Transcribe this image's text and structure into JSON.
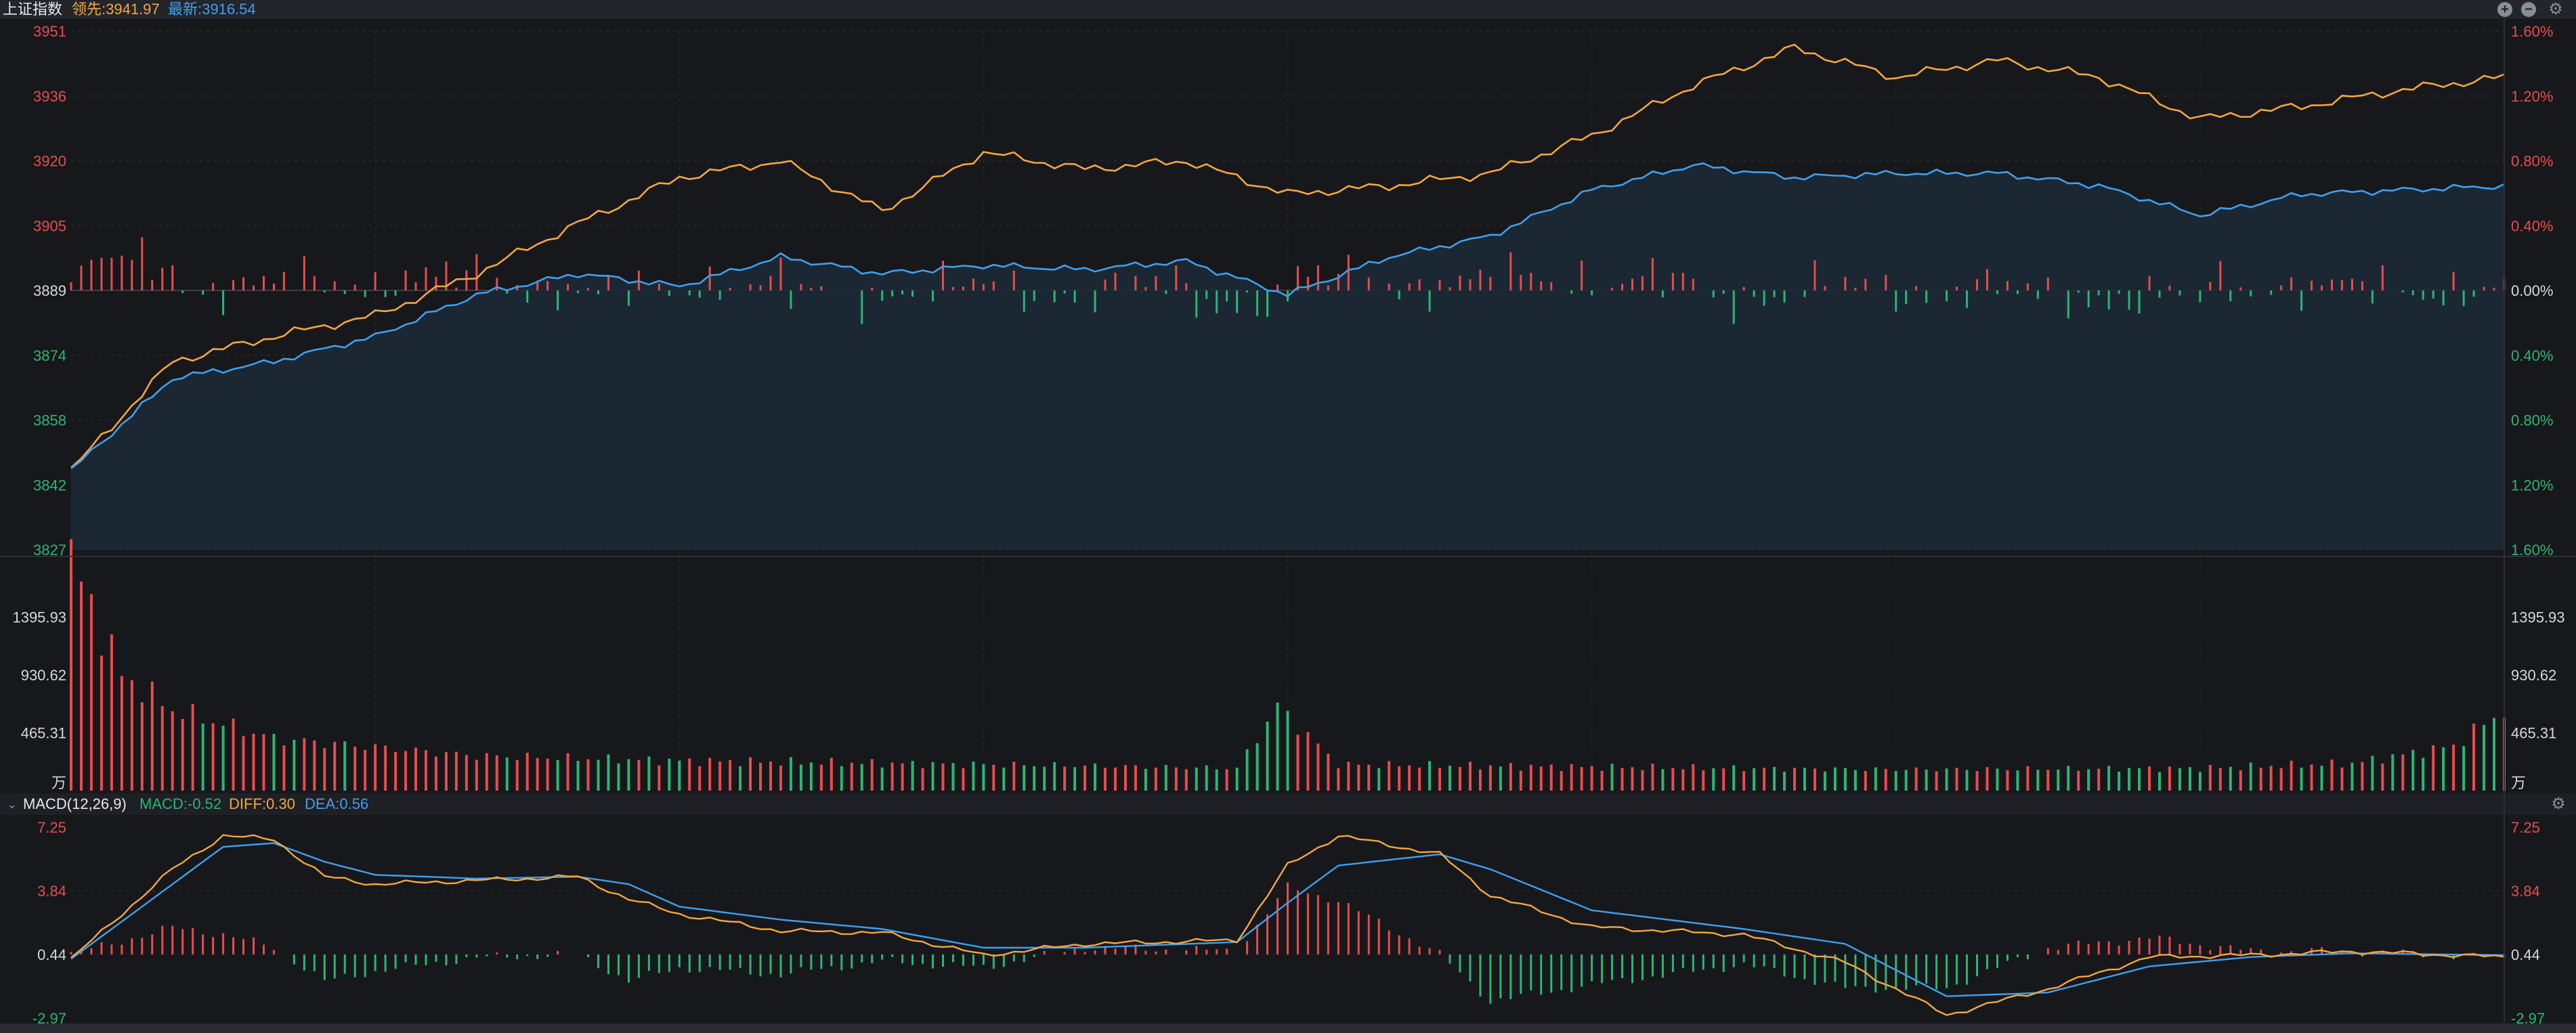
{
  "header": {
    "index_name": "上证指数",
    "lead_text": "领先:3941.97",
    "latest_text": "最新:3916.54"
  },
  "macd_header": {
    "name": "MACD(12,26,9)",
    "macd_text": "MACD:-0.52",
    "diff_text": "DIFF:0.30",
    "dea_text": "DEA:0.56"
  },
  "icons": {
    "zoom_in": "plus-circle-icon",
    "zoom_out": "minus-circle-icon",
    "settings": "gear-icon",
    "collapse": "chevron-down-icon"
  },
  "colors": {
    "up": "#e84c4c",
    "down": "#2bb673",
    "lead_line": "#f5a640",
    "latest_line": "#3fa0f0",
    "background": "#17181c"
  },
  "chart_data": [
    {
      "type": "line",
      "panel": "price",
      "y_left_ticks": [
        "3951",
        "3936",
        "3920",
        "3905",
        "3889",
        "3874",
        "3858",
        "3842",
        "3827"
      ],
      "y_right_ticks": [
        "1.60%",
        "1.20%",
        "0.80%",
        "0.40%",
        "0.00%",
        "0.40%",
        "0.80%",
        "1.20%",
        "1.60%"
      ],
      "ylim": [
        3827,
        3951
      ],
      "baseline": 3889,
      "x_points": 241,
      "series": [
        {
          "name": "领先",
          "color": "#f5a640",
          "keypoints": [
            [
              0,
              3846
            ],
            [
              10,
              3872
            ],
            [
              20,
              3878
            ],
            [
              30,
              3883
            ],
            [
              40,
              3893
            ],
            [
              50,
              3905
            ],
            [
              60,
              3916
            ],
            [
              70,
              3920
            ],
            [
              80,
              3908
            ],
            [
              90,
              3922
            ],
            [
              100,
              3918
            ],
            [
              110,
              3920
            ],
            [
              120,
              3912
            ],
            [
              130,
              3914
            ],
            [
              140,
              3917
            ],
            [
              150,
              3926
            ],
            [
              160,
              3938
            ],
            [
              170,
              3947
            ],
            [
              180,
              3940
            ],
            [
              190,
              3944
            ],
            [
              200,
              3940
            ],
            [
              210,
              3930
            ],
            [
              220,
              3933
            ],
            [
              230,
              3937
            ],
            [
              240,
              3940
            ]
          ]
        },
        {
          "name": "最新",
          "color": "#3fa0f0",
          "keypoints": [
            [
              0,
              3846
            ],
            [
              10,
              3868
            ],
            [
              20,
              3872
            ],
            [
              30,
              3878
            ],
            [
              40,
              3888
            ],
            [
              50,
              3893
            ],
            [
              60,
              3890
            ],
            [
              70,
              3897
            ],
            [
              80,
              3893
            ],
            [
              90,
              3895
            ],
            [
              100,
              3894
            ],
            [
              110,
              3896
            ],
            [
              120,
              3888
            ],
            [
              130,
              3897
            ],
            [
              140,
              3902
            ],
            [
              150,
              3913
            ],
            [
              160,
              3919
            ],
            [
              170,
              3916
            ],
            [
              180,
              3917
            ],
            [
              190,
              3917
            ],
            [
              200,
              3914
            ],
            [
              210,
              3907
            ],
            [
              220,
              3912
            ],
            [
              230,
              3913
            ],
            [
              240,
              3914
            ]
          ]
        }
      ],
      "bars_note": "red bars above 0.00% line, green bars below"
    },
    {
      "type": "bar",
      "panel": "volume",
      "y_ticks": [
        "1395.93",
        "930.62",
        "465.31"
      ],
      "unit_label": "万",
      "ylim": [
        0,
        1861.24
      ],
      "x_points": 241,
      "profile": [
        [
          0,
          1861
        ],
        [
          5,
          930
        ],
        [
          10,
          650
        ],
        [
          20,
          420
        ],
        [
          40,
          280
        ],
        [
          60,
          240
        ],
        [
          80,
          220
        ],
        [
          100,
          200
        ],
        [
          115,
          180
        ],
        [
          119,
          680
        ],
        [
          125,
          210
        ],
        [
          150,
          190
        ],
        [
          180,
          170
        ],
        [
          210,
          180
        ],
        [
          225,
          220
        ],
        [
          235,
          360
        ],
        [
          240,
          650
        ]
      ]
    },
    {
      "type": "bar",
      "panel": "macd",
      "y_ticks": [
        "7.25",
        "3.84",
        "0.44",
        "-2.97"
      ],
      "ylim": [
        -2.97,
        7.25
      ],
      "series": [
        {
          "name": "DIFF",
          "value": 0.3,
          "color": "#f5a640",
          "keypoints": [
            [
              0,
              0.2
            ],
            [
              10,
              5.0
            ],
            [
              15,
              6.8
            ],
            [
              20,
              6.6
            ],
            [
              25,
              4.6
            ],
            [
              30,
              4.2
            ],
            [
              40,
              4.4
            ],
            [
              50,
              4.6
            ],
            [
              55,
              3.4
            ],
            [
              60,
              2.6
            ],
            [
              70,
              1.7
            ],
            [
              80,
              1.6
            ],
            [
              90,
              0.4
            ],
            [
              100,
              1.0
            ],
            [
              115,
              1.2
            ],
            [
              120,
              5.2
            ],
            [
              125,
              6.8
            ],
            [
              135,
              5.8
            ],
            [
              140,
              3.6
            ],
            [
              150,
              1.9
            ],
            [
              165,
              1.5
            ],
            [
              175,
              0.0
            ],
            [
              185,
              -2.8
            ],
            [
              195,
              -1.4
            ],
            [
              205,
              0.3
            ],
            [
              215,
              0.4
            ],
            [
              225,
              0.6
            ],
            [
              240,
              0.3
            ]
          ]
        },
        {
          "name": "DEA",
          "value": 0.56,
          "color": "#3fa0f0",
          "keypoints": [
            [
              0,
              0.2
            ],
            [
              10,
              4.2
            ],
            [
              15,
              6.2
            ],
            [
              20,
              6.4
            ],
            [
              25,
              5.4
            ],
            [
              30,
              4.7
            ],
            [
              40,
              4.5
            ],
            [
              50,
              4.6
            ],
            [
              55,
              4.2
            ],
            [
              60,
              3.0
            ],
            [
              70,
              2.3
            ],
            [
              80,
              1.8
            ],
            [
              90,
              0.8
            ],
            [
              100,
              0.8
            ],
            [
              115,
              1.1
            ],
            [
              120,
              3.2
            ],
            [
              125,
              5.2
            ],
            [
              135,
              5.8
            ],
            [
              140,
              5.0
            ],
            [
              150,
              2.8
            ],
            [
              165,
              1.8
            ],
            [
              175,
              1.0
            ],
            [
              185,
              -1.8
            ],
            [
              195,
              -1.6
            ],
            [
              205,
              -0.2
            ],
            [
              215,
              0.3
            ],
            [
              225,
              0.5
            ],
            [
              240,
              0.4
            ]
          ]
        },
        {
          "name": "MACD",
          "value": -0.52,
          "note": "histogram = 2*(DIFF-DEA)"
        }
      ]
    }
  ]
}
